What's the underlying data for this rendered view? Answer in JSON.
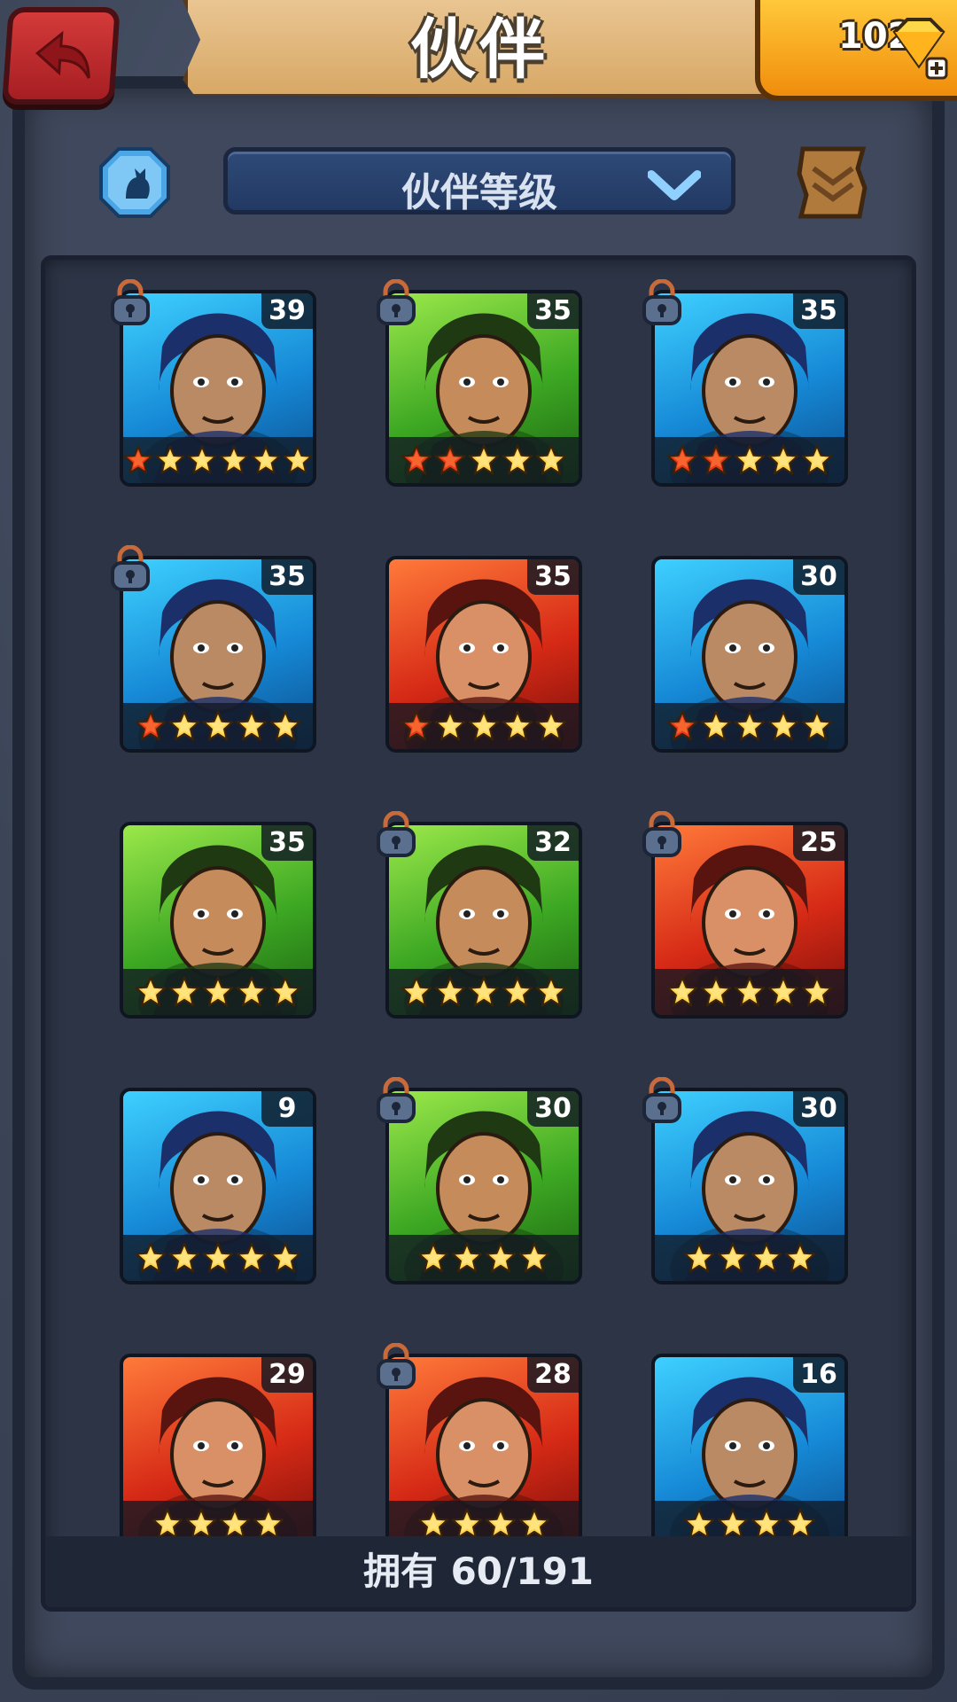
{
  "header": {
    "title": "伙伴",
    "gems": "102",
    "colors": {
      "back": "#c82a2e",
      "parchment": "#e3bb7e",
      "gold": "#f7a722"
    }
  },
  "toolbar": {
    "sort_label": "伙伴等级",
    "filter_icon": "cat-silhouette-icon",
    "scroll_icon": "scroll-icon"
  },
  "companions": [
    {
      "level": "39",
      "stars_filled": 1,
      "stars_total": 6,
      "locked": true,
      "color": "blue"
    },
    {
      "level": "35",
      "stars_filled": 2,
      "stars_total": 5,
      "locked": true,
      "color": "green"
    },
    {
      "level": "35",
      "stars_filled": 2,
      "stars_total": 5,
      "locked": true,
      "color": "blue"
    },
    {
      "level": "35",
      "stars_filled": 1,
      "stars_total": 5,
      "locked": true,
      "color": "blue"
    },
    {
      "level": "35",
      "stars_filled": 1,
      "stars_total": 5,
      "locked": false,
      "color": "red"
    },
    {
      "level": "30",
      "stars_filled": 1,
      "stars_total": 5,
      "locked": false,
      "color": "blue"
    },
    {
      "level": "35",
      "stars_filled": 0,
      "stars_total": 5,
      "locked": false,
      "color": "green"
    },
    {
      "level": "32",
      "stars_filled": 0,
      "stars_total": 5,
      "locked": true,
      "color": "green"
    },
    {
      "level": "25",
      "stars_filled": 0,
      "stars_total": 5,
      "locked": true,
      "color": "red"
    },
    {
      "level": "9",
      "stars_filled": 0,
      "stars_total": 5,
      "locked": false,
      "color": "blue"
    },
    {
      "level": "30",
      "stars_filled": 0,
      "stars_total": 4,
      "locked": true,
      "color": "green"
    },
    {
      "level": "30",
      "stars_filled": 0,
      "stars_total": 4,
      "locked": true,
      "color": "blue"
    },
    {
      "level": "29",
      "stars_filled": 0,
      "stars_total": 4,
      "locked": false,
      "color": "red"
    },
    {
      "level": "28",
      "stars_filled": 0,
      "stars_total": 4,
      "locked": true,
      "color": "red"
    },
    {
      "level": "16",
      "stars_filled": 0,
      "stars_total": 4,
      "locked": false,
      "color": "blue"
    }
  ],
  "footer": {
    "owned_label": "拥有 60/191"
  }
}
